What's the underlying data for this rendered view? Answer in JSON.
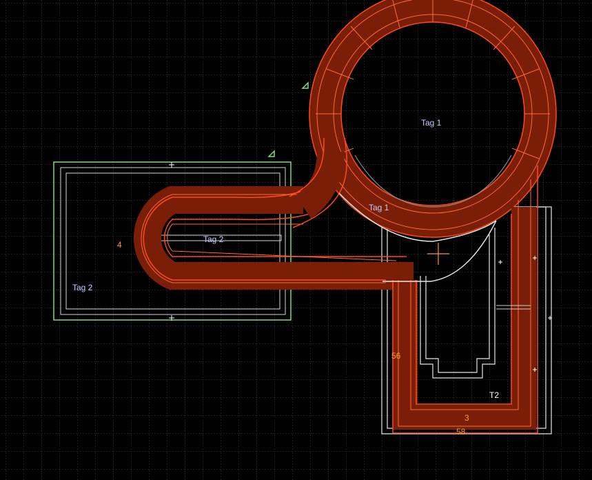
{
  "editor": {
    "background_color": "#000000",
    "grid_color": "#3a3a3a",
    "track_color": "#ff4a1a",
    "track_fill": "#7a1e08",
    "selection_outline_color": "#7ddc7d",
    "wire_color": "#ffffff",
    "guide_color": "#8a8a8a",
    "cursor_color": "#ff9a2a"
  },
  "labels": {
    "tag1_top": "Tag 1",
    "tag1_lower": "Tag 1",
    "tag2_center": "Tag 2",
    "tag2_left": "Tag 2",
    "t2": "T2",
    "num_4": "4",
    "num_56": "56",
    "num_3": "3",
    "num_58": "58"
  },
  "icons": {
    "marker_a": "triangle-marker-icon",
    "marker_b": "triangle-marker-icon",
    "cursor": "crosshair-icon"
  }
}
